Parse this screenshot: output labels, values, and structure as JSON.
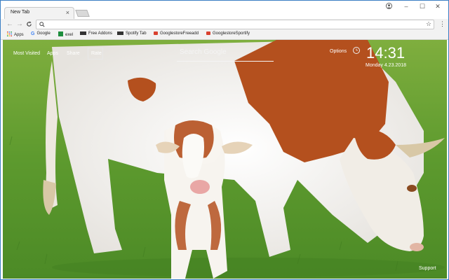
{
  "browser": {
    "tab_title": "New Tab",
    "tab_close": "×",
    "window_controls": {
      "minimize": "–",
      "maximize": "☐",
      "close": "✕"
    },
    "profile_icon": "user-icon",
    "nav": {
      "back": "←",
      "forward": "→",
      "reload": "C"
    },
    "star_icon": "☆",
    "menu_icon": "⋮",
    "search_glyph": "🔍"
  },
  "bookmarks": [
    {
      "label": "Apps",
      "icon": "apps-grid-icon",
      "color": "#e04a3f"
    },
    {
      "label": "Google",
      "icon": "google-icon",
      "color": "#4285f4"
    },
    {
      "label": "exel",
      "icon": "sheets-icon",
      "color": "#1e8e3e"
    },
    {
      "label": "Free Addons",
      "icon": "addon-icon",
      "color": "#333333"
    },
    {
      "label": "Spotify Tab",
      "icon": "addon-icon",
      "color": "#333333"
    },
    {
      "label": "GooglestoreFreeadd",
      "icon": "store-icon",
      "color": "#d9412f"
    },
    {
      "label": "GooglestoreSportify",
      "icon": "store-icon",
      "color": "#d9412f"
    }
  ],
  "ntp": {
    "links": {
      "most_visited": "Most Visited",
      "apps": "Apps",
      "share": "Share",
      "rate": "Rate"
    },
    "search_placeholder": "Search Google",
    "options": "Options",
    "time": "14:31",
    "date": "Monday  4.23.2018",
    "support": "Support"
  },
  "colors": {
    "accent_border": "#3a7fc4",
    "grass": "#5d9a2e",
    "cow_spot": "#b4501e"
  }
}
